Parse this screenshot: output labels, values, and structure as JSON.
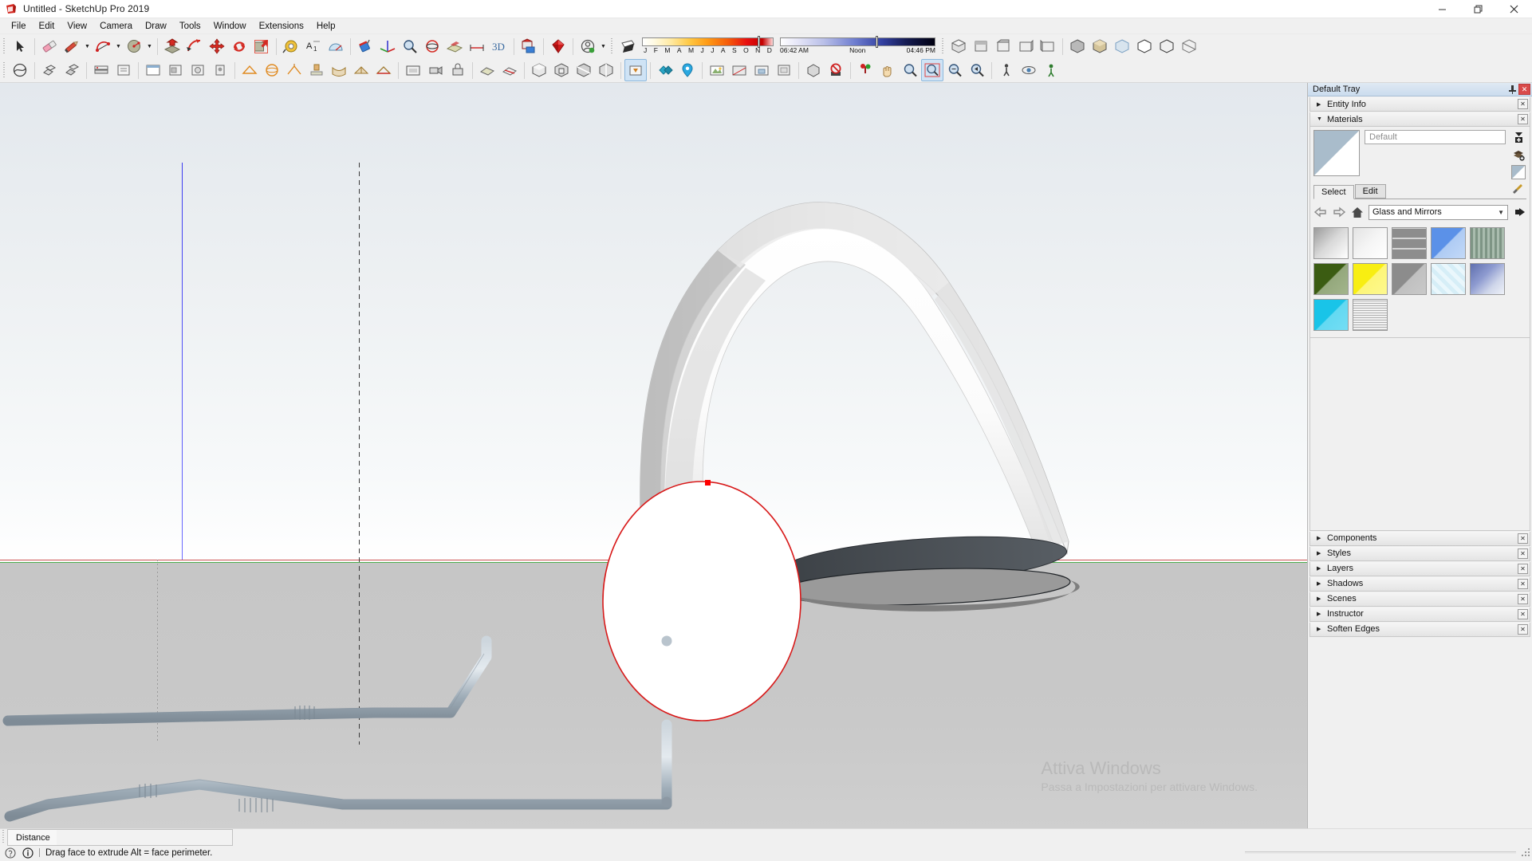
{
  "window": {
    "title": "Untitled - SketchUp Pro 2019",
    "logo_icon": "sketchup-logo-icon",
    "buttons": [
      {
        "name": "minimize-button",
        "glyph": "─"
      },
      {
        "name": "restore-button",
        "glyph": "❐"
      },
      {
        "name": "close-button",
        "glyph": "✕"
      }
    ]
  },
  "menubar": {
    "items": [
      "File",
      "Edit",
      "View",
      "Camera",
      "Draw",
      "Tools",
      "Window",
      "Extensions",
      "Help"
    ]
  },
  "toolbars": {
    "row1": [
      {
        "name": "select-tool",
        "icon": "arrow-cursor-icon"
      },
      {
        "name": "eraser-tool",
        "icon": "eraser-icon"
      },
      {
        "name": "line-tool",
        "icon": "pencil-icon",
        "has_caret": true
      },
      {
        "name": "arc-tool",
        "icon": "arc-icon",
        "has_caret": true
      },
      {
        "name": "circle-tool",
        "icon": "circle-shape-icon",
        "has_caret": true
      },
      {
        "name": "pushpull-tool",
        "icon": "push-pull-icon"
      },
      {
        "name": "followme-tool",
        "icon": "follow-me-icon"
      },
      {
        "name": "move-tool",
        "icon": "move-arrows-icon"
      },
      {
        "name": "rotate-tool",
        "icon": "rotate-arrows-icon"
      },
      {
        "name": "scale-tool",
        "icon": "scale-box-icon"
      },
      {
        "name": "tape-measure-tool",
        "icon": "tape-measure-icon"
      },
      {
        "name": "text-tool",
        "icon": "text-label-icon"
      },
      {
        "name": "protractor-tool",
        "icon": "protractor-icon"
      },
      {
        "name": "paint-bucket-tool",
        "icon": "paint-bucket-icon"
      },
      {
        "name": "axes-tool",
        "icon": "axes-icon"
      },
      {
        "name": "zoom-window-tool",
        "icon": "magnifier-icon"
      },
      {
        "name": "orbit-tool",
        "icon": "orbit-icon"
      },
      {
        "name": "section-plane-tool",
        "icon": "section-plane-icon"
      },
      {
        "name": "dimension-tool",
        "icon": "dimension-icon"
      },
      {
        "name": "3d-text-tool",
        "icon": "threed-text-icon"
      },
      {
        "name": "warehouse-tool",
        "icon": "warehouse-icon"
      },
      {
        "name": "extension-warehouse",
        "icon": "ruby-gem-icon"
      },
      {
        "name": "account-button",
        "icon": "user-circle-icon",
        "has_caret": true
      },
      {
        "name": "shadows-toggle",
        "icon": "shadow-plane-icon"
      }
    ],
    "row2": [
      {
        "name": "sandbox-tool",
        "icon": "sandbox-icon"
      },
      {
        "name": "solid-tools-outer",
        "icon": "solid-outer-icon"
      },
      {
        "name": "solid-tools-intersect",
        "icon": "solid-intersect-icon"
      },
      {
        "name": "standard-views-iso",
        "icon": "iso-view-icon"
      },
      {
        "name": "standard-views-top",
        "icon": "top-view-icon"
      },
      {
        "name": "styles-shaded",
        "icon": "shaded-style-icon"
      },
      {
        "name": "styles-texture",
        "icon": "texture-style-icon"
      },
      {
        "name": "styles-xray",
        "icon": "xray-style-icon"
      },
      {
        "name": "styles-monochrome",
        "icon": "monochrome-style-icon"
      },
      {
        "name": "section-display-1",
        "icon": "section-display-icon"
      },
      {
        "name": "section-display-2",
        "icon": "section-cut-icon"
      },
      {
        "name": "layers-tool",
        "icon": "layers-icon"
      },
      {
        "name": "views-front",
        "icon": "front-view-icon"
      },
      {
        "name": "views-back",
        "icon": "back-view-icon"
      },
      {
        "name": "views-left",
        "icon": "left-view-icon"
      },
      {
        "name": "views-right",
        "icon": "right-view-icon"
      },
      {
        "name": "camera-perspective",
        "icon": "perspective-icon"
      },
      {
        "name": "camera-parallel",
        "icon": "parallel-icon"
      },
      {
        "name": "walk-tool",
        "icon": "walk-icon"
      },
      {
        "name": "lookaround-tool",
        "icon": "look-around-icon"
      },
      {
        "name": "position-camera-tool",
        "icon": "position-camera-icon"
      },
      {
        "name": "dynamic-components",
        "icon": "dynamic-component-icon"
      },
      {
        "name": "interact-tool",
        "icon": "interact-hand-icon"
      },
      {
        "name": "zoom-tool",
        "icon": "zoom-icon"
      },
      {
        "name": "zoom-extents",
        "icon": "zoom-extents-icon"
      },
      {
        "name": "pan-tool",
        "icon": "pan-hand-icon"
      },
      {
        "name": "previous-view",
        "icon": "previous-view-icon"
      },
      {
        "name": "photo-match",
        "icon": "photo-match-icon"
      },
      {
        "name": "sandbox-smoove",
        "icon": "smoove-icon"
      },
      {
        "name": "sandbox-stamp",
        "icon": "stamp-icon"
      }
    ]
  },
  "shadow_settings": {
    "month_slider": {
      "name": "month-slider",
      "labels": [
        "J",
        "F",
        "M",
        "A",
        "M",
        "J",
        "J",
        "A",
        "S",
        "O",
        "N",
        "D"
      ],
      "thumb_percent": 88
    },
    "time_slider": {
      "name": "time-slider",
      "sunrise": "06:42 AM",
      "noon": "Noon",
      "sunset": "04:46 PM",
      "thumb_percent": 62
    }
  },
  "tray": {
    "title": "Default Tray",
    "pin_icon": "pin-icon",
    "close_icon": "close-icon",
    "sections": [
      {
        "label": "Entity Info",
        "expanded": false
      },
      {
        "label": "Materials",
        "expanded": true
      }
    ],
    "materials": {
      "preview_name": "material-preview-swatch",
      "current_name": "Default",
      "side_icons": [
        "create-material-icon",
        "material-list-icon",
        "display-secondary-icon"
      ],
      "tabs": [
        {
          "label": "Select",
          "selected": true
        },
        {
          "label": "Edit",
          "selected": false
        }
      ],
      "eyedropper_icon": "eyedropper-icon",
      "nav": {
        "back_icon": "arrow-left-icon",
        "forward_icon": "arrow-right-icon",
        "home_icon": "home-icon",
        "details_icon": "details-arrow-icon"
      },
      "library": "Glass and Mirrors",
      "swatches": [
        {
          "name": "swatch-mirror",
          "style": "linear-gradient(135deg,#9b9b9b 0%,#d8d8d8 48%,#ffffff 100%)"
        },
        {
          "name": "swatch-translucent-glass",
          "style": "linear-gradient(135deg,#e8e8e8 0%,#f5f5f5 50%,#ffffff 100%)"
        },
        {
          "name": "swatch-glass-block",
          "style": "repeating-linear-gradient(0deg,#8d8d8d 0 11px,#cfcfcf 11px 13px),repeating-linear-gradient(90deg,#8d8d8d 0 12px,#cfcfcf 12px 14px)"
        },
        {
          "name": "swatch-glass-blue",
          "style": "linear-gradient(135deg,#5b91e8 0%,#5b91e8 49%,#aecbf4 51%,#c3d9f7 100%)"
        },
        {
          "name": "swatch-glass-green-tint",
          "style": "repeating-linear-gradient(90deg,#7e9585 0 3px,#a9bcae 3px 6px)"
        },
        {
          "name": "swatch-glass-dark-green",
          "style": "linear-gradient(135deg,#3b5c12 0%,#3b5c12 49%,#94a87c 51%,#a3b58c 100%)"
        },
        {
          "name": "swatch-glass-yellow",
          "style": "linear-gradient(135deg,#f8ee12 0%,#f8ee12 49%,#fdf679 51%,#fdf88f 100%)"
        },
        {
          "name": "swatch-glass-gray",
          "style": "linear-gradient(135deg,#8c8c8c 0%,#8c8c8c 49%,#c0c0c0 51%,#c9c9c9 100%)"
        },
        {
          "name": "swatch-glass-safety",
          "style": "repeating-linear-gradient(45deg,#d6eef7 0 5px,#eaf7fc 5px 10px)"
        },
        {
          "name": "swatch-glass-sky-reflect",
          "style": "linear-gradient(135deg,#5f6fae 0%,#8e9bd0 40%,#cfd6ea 70%,#eef1f8 100%)"
        },
        {
          "name": "swatch-glass-cyan",
          "style": "linear-gradient(135deg,#19c4e8 0%,#19c4e8 49%,#63d9f2 51%,#74ddf4 100%)"
        },
        {
          "name": "swatch-glass-frosted",
          "style": "repeating-linear-gradient(0deg,#bdbdbd 0 1px,#f2f2f2 1px 3px),repeating-linear-gradient(90deg,#adadad 0 1px,#ededed 1px 2px)"
        }
      ]
    },
    "collapsed_sections": [
      "Components",
      "Styles",
      "Layers",
      "Shadows",
      "Scenes",
      "Instructor",
      "Soften Edges"
    ]
  },
  "viewport": {
    "name": "model-viewport",
    "watermark": {
      "line1": "Attiva Windows",
      "line2": "Passa a Impostazioni per attivare Windows."
    },
    "colors": {
      "axis_green": "#2e9c2e",
      "axis_red": "#c02828",
      "axis_blue": "#3a3af0",
      "selection_red": "#d81a1a",
      "ground": "#c6c6c6",
      "pipe": "#aab6bf"
    }
  },
  "status": {
    "measurement_label": "Distance",
    "measurement_value": "",
    "hint_icon_1": "help-bulb-icon",
    "hint_icon_2": "info-circle-icon",
    "hint": "Drag face to extrude  Alt = face perimeter."
  }
}
